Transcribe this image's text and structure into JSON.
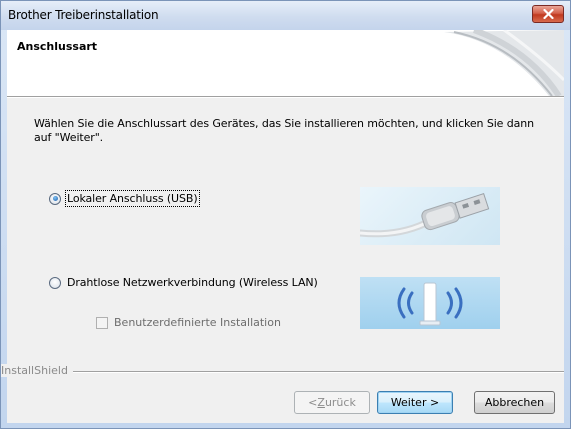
{
  "window": {
    "title": "Brother Treiberinstallation"
  },
  "header": {
    "title": "Anschlussart"
  },
  "main": {
    "instruction": "Wählen Sie die Anschlussart des Gerätes, das Sie installieren möchten, und klicken Sie dann auf \"Weiter\".",
    "options": [
      {
        "label": "Lokaler Anschluss (USB)",
        "checked": true
      },
      {
        "label": "Drahtlose Netzwerkverbindung (Wireless LAN)",
        "checked": false
      }
    ],
    "custom_install": {
      "label": "Benutzerdefinierte Installation",
      "checked": false,
      "enabled": false
    }
  },
  "footer": {
    "brand": "InstallShield",
    "back_prefix": "< ",
    "back_mnemonic": "Z",
    "back_rest": "urück",
    "next_label": "Weiter >",
    "cancel_label": "Abbrechen"
  },
  "colors": {
    "title_bar": "#cfdcef",
    "close_button": "#c0391f",
    "dialog_bg": "#f0f0f0",
    "header_bg": "#ffffff",
    "default_button_border": "#3c7fb1"
  },
  "icons": {
    "close": "close-icon",
    "usb": "usb-cable-icon",
    "wifi": "wireless-router-icon"
  }
}
